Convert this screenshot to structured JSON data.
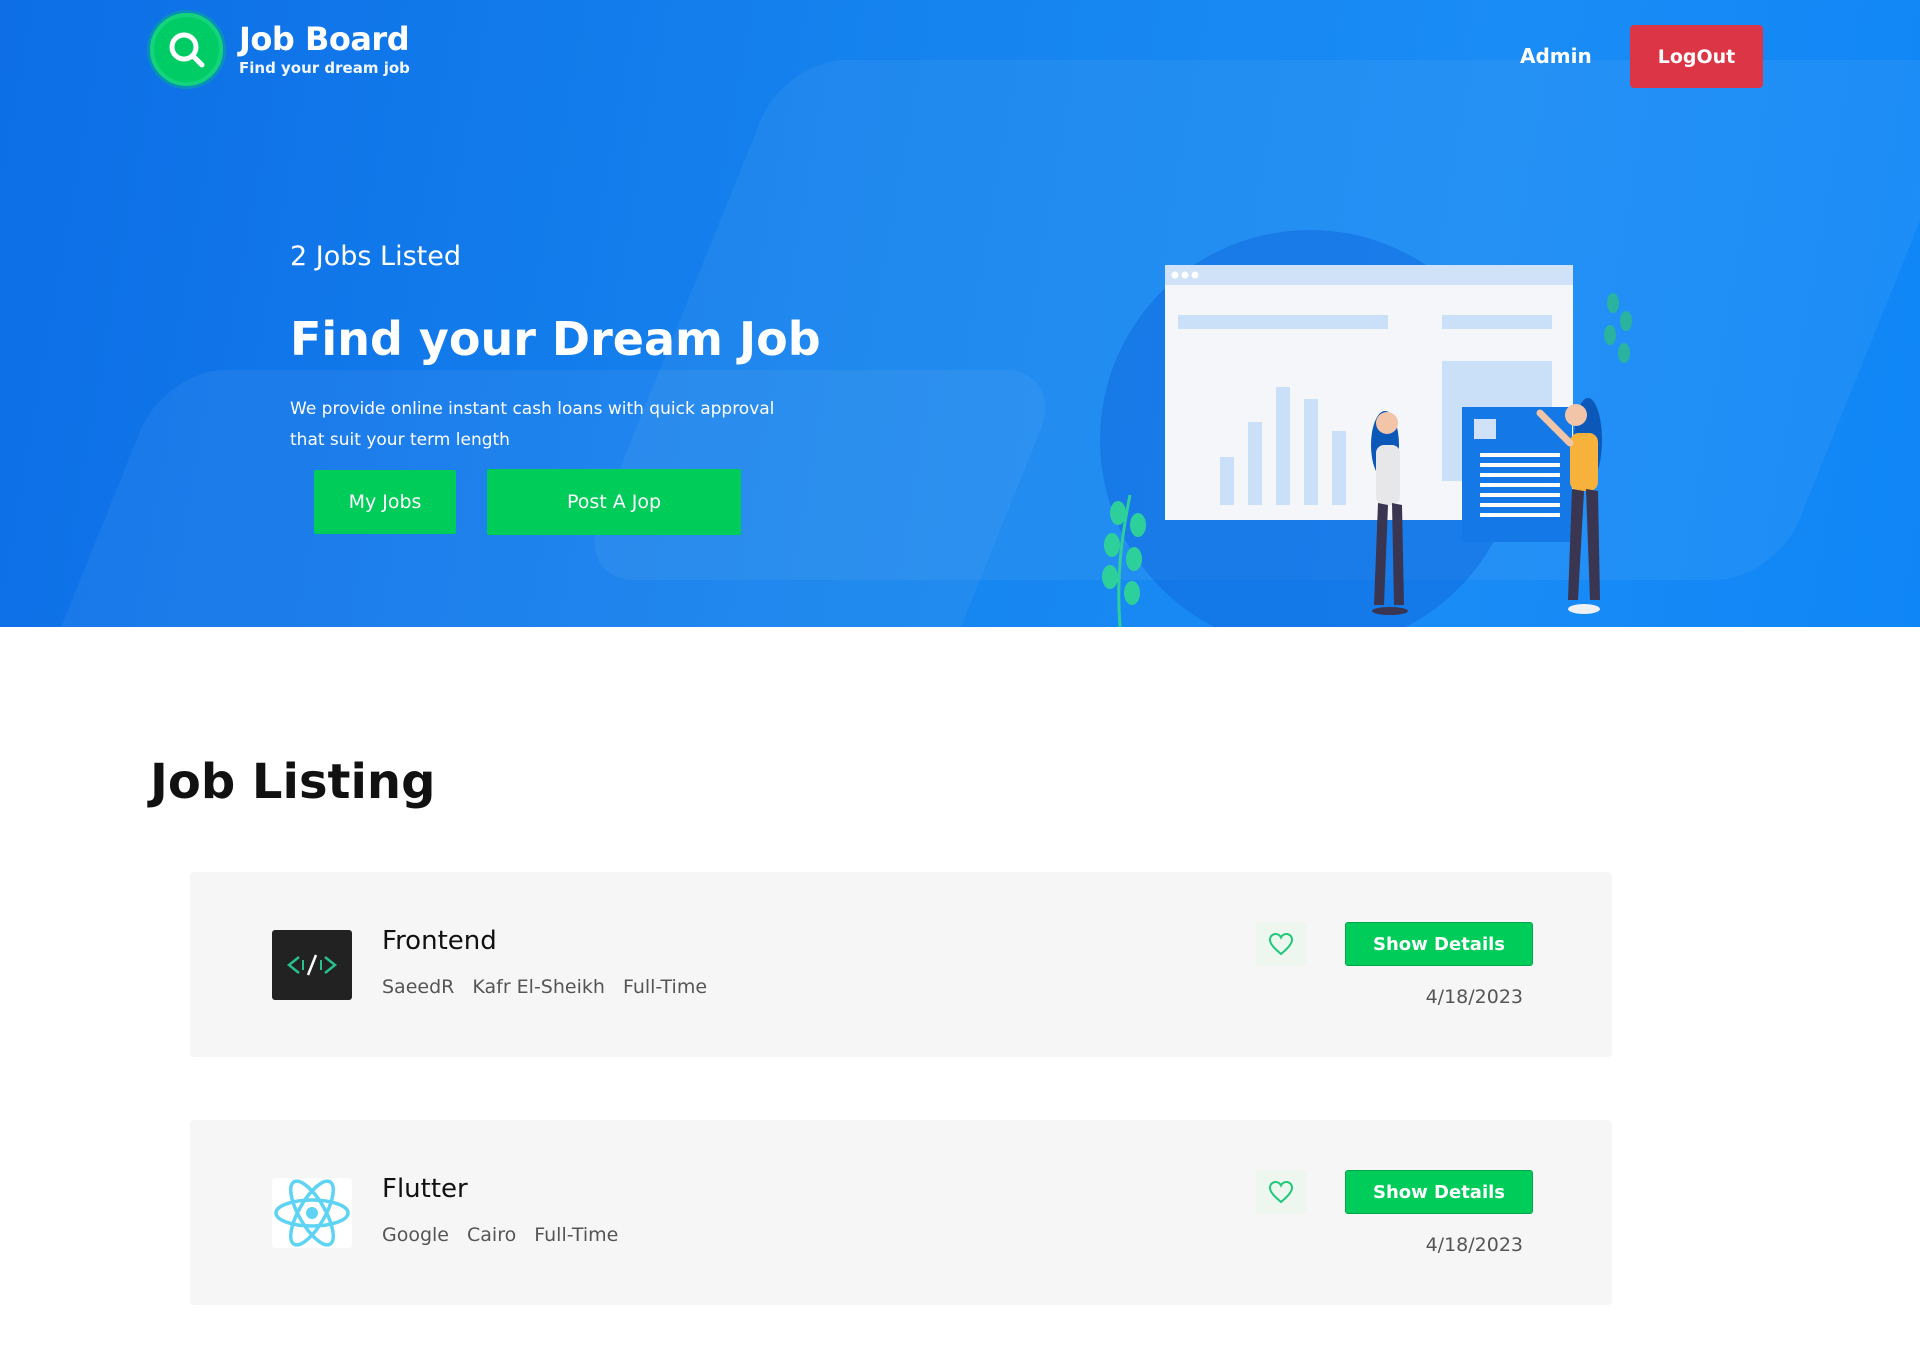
{
  "brand": {
    "title": "Job Board",
    "tagline": "Find your dream job",
    "logo_icon": "search-icon",
    "accent": "#00cc5a"
  },
  "nav": {
    "admin_label": "Admin",
    "logout_label": "LogOut",
    "logout_color": "#dc3545"
  },
  "hero": {
    "count_label": "2 Jobs Listed",
    "title": "Find your Dream Job",
    "description": "We provide online instant cash loans with quick approval that suit your term length",
    "my_jobs_label": "My Jobs",
    "post_job_label": "Post A Jop",
    "background": "#1583ee"
  },
  "listing": {
    "title": "Job Listing",
    "jobs": [
      {
        "title": "Frontend",
        "company": "SaeedR",
        "location": "Kafr El-Sheikh",
        "type": "Full-Time",
        "date": "4/18/2023",
        "logo_icon": "code-icon",
        "details_label": "Show Details",
        "favorite_icon": "heart-icon"
      },
      {
        "title": "Flutter",
        "company": "Google",
        "location": "Cairo",
        "type": "Full-Time",
        "date": "4/18/2023",
        "logo_icon": "react-atom-icon",
        "details_label": "Show Details",
        "favorite_icon": "heart-icon"
      }
    ]
  }
}
